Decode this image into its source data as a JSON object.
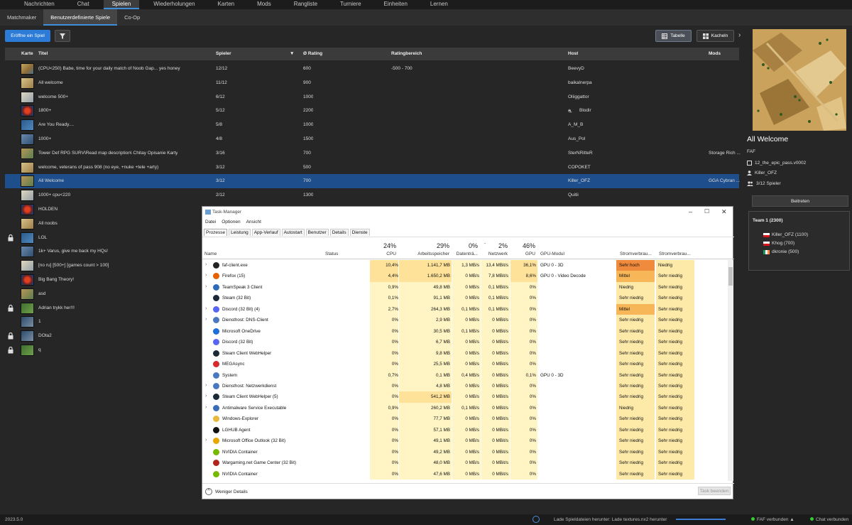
{
  "nav": {
    "tabs": [
      "Nachrichten",
      "Chat",
      "Spielen",
      "Wiederholungen",
      "Karten",
      "Mods",
      "Rangliste",
      "Turniere",
      "Einheiten",
      "Lernen"
    ],
    "active": "Spielen"
  },
  "subnav": {
    "tabs": [
      "Matchmaker",
      "Benutzerdefinierte Spiele",
      "Co-Op"
    ],
    "active": "Benutzerdefinierte Spiele"
  },
  "toolbar": {
    "create_label": "Eröffne ein Spiel",
    "table_label": "Tabelle",
    "tiles_label": "Kacheln"
  },
  "table": {
    "headers": {
      "map": "Karte",
      "title": "Titel",
      "players": "Spieler",
      "rating": "Ø Rating",
      "range": "Ratingbereich",
      "host": "Host",
      "mods": "Mods"
    },
    "rows": [
      {
        "title": "(CPU<250) Babe, time for your daily match of Noob Gap... yes honey",
        "players": "12/12",
        "rating": "600",
        "range": "-500 - 700",
        "host": "BeevyD",
        "mods": "",
        "lock": false,
        "thumb": "t1"
      },
      {
        "title": "All welcome",
        "players": "11/12",
        "rating": "900",
        "range": "",
        "host": "baikalnerpa",
        "mods": "",
        "lock": false,
        "thumb": "t2"
      },
      {
        "title": "welcome 500+",
        "players": "6/12",
        "rating": "1000",
        "range": "",
        "host": "Oliiggattor",
        "mods": "",
        "lock": false,
        "thumb": "t3"
      },
      {
        "title": "1800+",
        "players": "5/12",
        "rating": "2200",
        "range": "",
        "host": "Blodir",
        "mods": "",
        "lock": false,
        "thumb": "t4"
      },
      {
        "title": "Are You Ready....",
        "players": "5/8",
        "rating": "1000",
        "range": "",
        "host": "A_M_B",
        "mods": "",
        "lock": false,
        "thumb": "t5"
      },
      {
        "title": "1000+",
        "players": "4/8",
        "rating": "1500",
        "range": "",
        "host": "Aus_Pol",
        "mods": "",
        "lock": false,
        "thumb": "t6"
      },
      {
        "title": "Tower Def RPG SURV\\Read map description\\ Chitay Opisanie Karty",
        "players": "3/16",
        "rating": "700",
        "range": "",
        "host": "SterNRitteR",
        "mods": "Storage Rich ...",
        "lock": false,
        "thumb": "t7"
      },
      {
        "title": "welcome, veterans of pass 908 (no eye, +nuke +tele +arty)",
        "players": "3/12",
        "rating": "500",
        "range": "",
        "host": "COPOKET",
        "mods": "",
        "lock": false,
        "thumb": "t2"
      },
      {
        "title": "All Welcome",
        "players": "3/12",
        "rating": "700",
        "range": "",
        "host": "Killer_OFZ",
        "mods": "GGA Cybran ...",
        "lock": false,
        "thumb": "t7",
        "selected": true
      },
      {
        "title": "1000+ cpu<220",
        "players": "2/12",
        "rating": "1300",
        "range": "",
        "host": "Quitii",
        "mods": "",
        "lock": false,
        "thumb": "t3"
      },
      {
        "title": "HOLDEN",
        "players": "",
        "rating": "",
        "range": "",
        "host": "",
        "mods": "",
        "lock": false,
        "thumb": "t4"
      },
      {
        "title": "All noobs",
        "players": "",
        "rating": "",
        "range": "",
        "host": "",
        "mods": "",
        "lock": false,
        "thumb": "t2"
      },
      {
        "title": "LOL",
        "players": "",
        "rating": "",
        "range": "",
        "host": "",
        "mods": "",
        "lock": true,
        "thumb": "t5"
      },
      {
        "title": "1k+ Varus, give me back my HQs!",
        "players": "",
        "rating": "",
        "range": "",
        "host": "",
        "mods": "",
        "lock": false,
        "thumb": "t6"
      },
      {
        "title": "[no ru] [500+] [games count > 100]",
        "players": "",
        "rating": "",
        "range": "",
        "host": "",
        "mods": "",
        "lock": false,
        "thumb": "t3"
      },
      {
        "title": "Big Bang Theory!",
        "players": "",
        "rating": "",
        "range": "",
        "host": "",
        "mods": "",
        "lock": false,
        "thumb": "t4"
      },
      {
        "title": "asd",
        "players": "",
        "rating": "",
        "range": "",
        "host": "",
        "mods": "",
        "lock": false,
        "thumb": "t7"
      },
      {
        "title": "Adrian trykk her!!!",
        "players": "",
        "rating": "",
        "range": "",
        "host": "",
        "mods": "",
        "lock": true,
        "thumb": "t8"
      },
      {
        "title": "1",
        "players": "",
        "rating": "",
        "range": "",
        "host": "",
        "mods": "",
        "lock": false,
        "thumb": "t9"
      },
      {
        "title": "DOta2",
        "players": "",
        "rating": "",
        "range": "",
        "host": "",
        "mods": "",
        "lock": true,
        "thumb": "t9"
      },
      {
        "title": "q",
        "players": "",
        "rating": "",
        "range": "",
        "host": "",
        "mods": "",
        "lock": true,
        "thumb": "t8"
      }
    ]
  },
  "detail": {
    "title": "All Welcome",
    "featured_mod": "FAF",
    "map_name": "12_the_epic_pass.v0002",
    "host": "Killer_OFZ",
    "players": "3/12 Spieler",
    "join_label": "Beitreten",
    "team_title": "Team 1 (2300)",
    "team_players": [
      {
        "name": "Killer_OFZ (1100)",
        "flag": "cz"
      },
      {
        "name": "Khog (700)",
        "flag": "cz"
      },
      {
        "name": "dkronie (500)",
        "flag": "ie"
      }
    ]
  },
  "status": {
    "version": "2023.5.0",
    "download": "Lade Spieldateien herunter: Lade textures.nx2 herunter",
    "faf": "FAF verbunden",
    "chat": "Chat verbunden"
  },
  "taskmanager": {
    "title": "Task-Manager",
    "menu": [
      "Datei",
      "Optionen",
      "Ansicht"
    ],
    "tabs": [
      "Prozesse",
      "Leistung",
      "App-Verlauf",
      "Autostart",
      "Benutzer",
      "Details",
      "Dienste"
    ],
    "active_tab": "Prozesse",
    "headers": {
      "name": "Name",
      "status": "Status",
      "cpu": "CPU",
      "mem": "Arbeitsspeicher",
      "disk": "Datenträ...",
      "net": "Netzwerk",
      "gpu": "GPU",
      "gpumod": "GPU-Modul",
      "power": "Stromverbrau...",
      "power2": "Stromverbrau..."
    },
    "percents": {
      "cpu": "24%",
      "mem": "29%",
      "disk": "0%",
      "net": "2%",
      "gpu": "46%"
    },
    "rows": [
      {
        "name": "faf-client.exe",
        "cpu": "10,4%",
        "mem": "1.141,7 MB",
        "disk": "1,3 MB/s",
        "net": "13,4 MBit/s",
        "gpu": "36,1%",
        "gpumod": "GPU 0 - 3D",
        "power": "Sehr hoch",
        "power2": "Niedrig",
        "expand": true
      },
      {
        "name": "Firefox (15)",
        "cpu": "4,4%",
        "mem": "1.650,2 MB",
        "disk": "0 MB/s",
        "net": "7,8 MBit/s",
        "gpu": "8,6%",
        "gpumod": "GPU 0 - Video Decode",
        "power": "Mittel",
        "power2": "Sehr niedrig",
        "expand": true
      },
      {
        "name": "TeamSpeak 3 Client",
        "cpu": "0,9%",
        "mem": "49,8 MB",
        "disk": "0 MB/s",
        "net": "0,1 MBit/s",
        "gpu": "0%",
        "gpumod": "",
        "power": "Niedrig",
        "power2": "Sehr niedrig",
        "expand": true
      },
      {
        "name": "Steam (32 Bit)",
        "cpu": "0,1%",
        "mem": "91,1 MB",
        "disk": "0 MB/s",
        "net": "0,1 MBit/s",
        "gpu": "0%",
        "gpumod": "",
        "power": "Sehr niedrig",
        "power2": "Sehr niedrig",
        "expand": false
      },
      {
        "name": "Discord (32 Bit) (4)",
        "cpu": "2,7%",
        "mem": "264,3 MB",
        "disk": "0,1 MB/s",
        "net": "0,1 MBit/s",
        "gpu": "0%",
        "gpumod": "",
        "power": "Mittel",
        "power2": "Sehr niedrig",
        "expand": true
      },
      {
        "name": "Diensthost: DNS-Client",
        "cpu": "0%",
        "mem": "2,9 MB",
        "disk": "0 MB/s",
        "net": "0 MBit/s",
        "gpu": "0%",
        "gpumod": "",
        "power": "Sehr niedrig",
        "power2": "Sehr niedrig",
        "expand": true
      },
      {
        "name": "Microsoft OneDrive",
        "cpu": "0%",
        "mem": "30,5 MB",
        "disk": "0,1 MB/s",
        "net": "0 MBit/s",
        "gpu": "0%",
        "gpumod": "",
        "power": "Sehr niedrig",
        "power2": "Sehr niedrig",
        "expand": false
      },
      {
        "name": "Discord (32 Bit)",
        "cpu": "0%",
        "mem": "6,7 MB",
        "disk": "0 MB/s",
        "net": "0 MBit/s",
        "gpu": "0%",
        "gpumod": "",
        "power": "Sehr niedrig",
        "power2": "Sehr niedrig",
        "expand": false
      },
      {
        "name": "Steam Client WebHelper",
        "cpu": "0%",
        "mem": "9,8 MB",
        "disk": "0 MB/s",
        "net": "0 MBit/s",
        "gpu": "0%",
        "gpumod": "",
        "power": "Sehr niedrig",
        "power2": "Sehr niedrig",
        "expand": false
      },
      {
        "name": "MEGAsync",
        "cpu": "0%",
        "mem": "25,5 MB",
        "disk": "0 MB/s",
        "net": "0 MBit/s",
        "gpu": "0%",
        "gpumod": "",
        "power": "Sehr niedrig",
        "power2": "Sehr niedrig",
        "expand": false
      },
      {
        "name": "System",
        "cpu": "0,7%",
        "mem": "0,1 MB",
        "disk": "0,4 MB/s",
        "net": "0 MBit/s",
        "gpu": "0,1%",
        "gpumod": "GPU 0 - 3D",
        "power": "Sehr niedrig",
        "power2": "Sehr niedrig",
        "expand": false
      },
      {
        "name": "Diensthost: Netzwerkdienst",
        "cpu": "0%",
        "mem": "4,8 MB",
        "disk": "0 MB/s",
        "net": "0 MBit/s",
        "gpu": "0%",
        "gpumod": "",
        "power": "Sehr niedrig",
        "power2": "Sehr niedrig",
        "expand": true
      },
      {
        "name": "Steam Client WebHelper (5)",
        "cpu": "0%",
        "mem": "541,2 MB",
        "disk": "0 MB/s",
        "net": "0 MBit/s",
        "gpu": "0%",
        "gpumod": "",
        "power": "Sehr niedrig",
        "power2": "Sehr niedrig",
        "expand": true
      },
      {
        "name": "Antimalware Service Executable",
        "cpu": "0,9%",
        "mem": "260,2 MB",
        "disk": "0,1 MB/s",
        "net": "0 MBit/s",
        "gpu": "0%",
        "gpumod": "",
        "power": "Niedrig",
        "power2": "Sehr niedrig",
        "expand": true
      },
      {
        "name": "Windows-Explorer",
        "cpu": "0%",
        "mem": "77,7 MB",
        "disk": "0 MB/s",
        "net": "0 MBit/s",
        "gpu": "0%",
        "gpumod": "",
        "power": "Sehr niedrig",
        "power2": "Sehr niedrig",
        "expand": false
      },
      {
        "name": "LGHUB Agent",
        "cpu": "0%",
        "mem": "57,1 MB",
        "disk": "0 MB/s",
        "net": "0 MBit/s",
        "gpu": "0%",
        "gpumod": "",
        "power": "Sehr niedrig",
        "power2": "Sehr niedrig",
        "expand": false
      },
      {
        "name": "Microsoft Office Outlook (32 Bit)",
        "cpu": "0%",
        "mem": "49,1 MB",
        "disk": "0 MB/s",
        "net": "0 MBit/s",
        "gpu": "0%",
        "gpumod": "",
        "power": "Sehr niedrig",
        "power2": "Sehr niedrig",
        "expand": true
      },
      {
        "name": "NVIDIA Container",
        "cpu": "0%",
        "mem": "49,2 MB",
        "disk": "0 MB/s",
        "net": "0 MBit/s",
        "gpu": "0%",
        "gpumod": "",
        "power": "Sehr niedrig",
        "power2": "Sehr niedrig",
        "expand": false
      },
      {
        "name": "Wargaming.net Game Center (32 Bit)",
        "cpu": "0%",
        "mem": "48,0 MB",
        "disk": "0 MB/s",
        "net": "0 MBit/s",
        "gpu": "0%",
        "gpumod": "",
        "power": "Sehr niedrig",
        "power2": "Sehr niedrig",
        "expand": false
      },
      {
        "name": "NVIDIA Container",
        "cpu": "0%",
        "mem": "47,6 MB",
        "disk": "0 MB/s",
        "net": "0 MBit/s",
        "gpu": "0%",
        "gpumod": "",
        "power": "Sehr niedrig",
        "power2": "Sehr niedrig",
        "expand": false
      }
    ],
    "fewer_details": "Weniger Details",
    "end_task": "Task beenden"
  },
  "colors": {
    "accent": "#2c7bd6",
    "selected_row": "#1e4f8c",
    "heat_light": "#fff4c4",
    "heat_mid": "#ffe29a",
    "power_high": "#f08a3c",
    "power_mid": "#f7b657",
    "power_low": "#fde9a8"
  }
}
